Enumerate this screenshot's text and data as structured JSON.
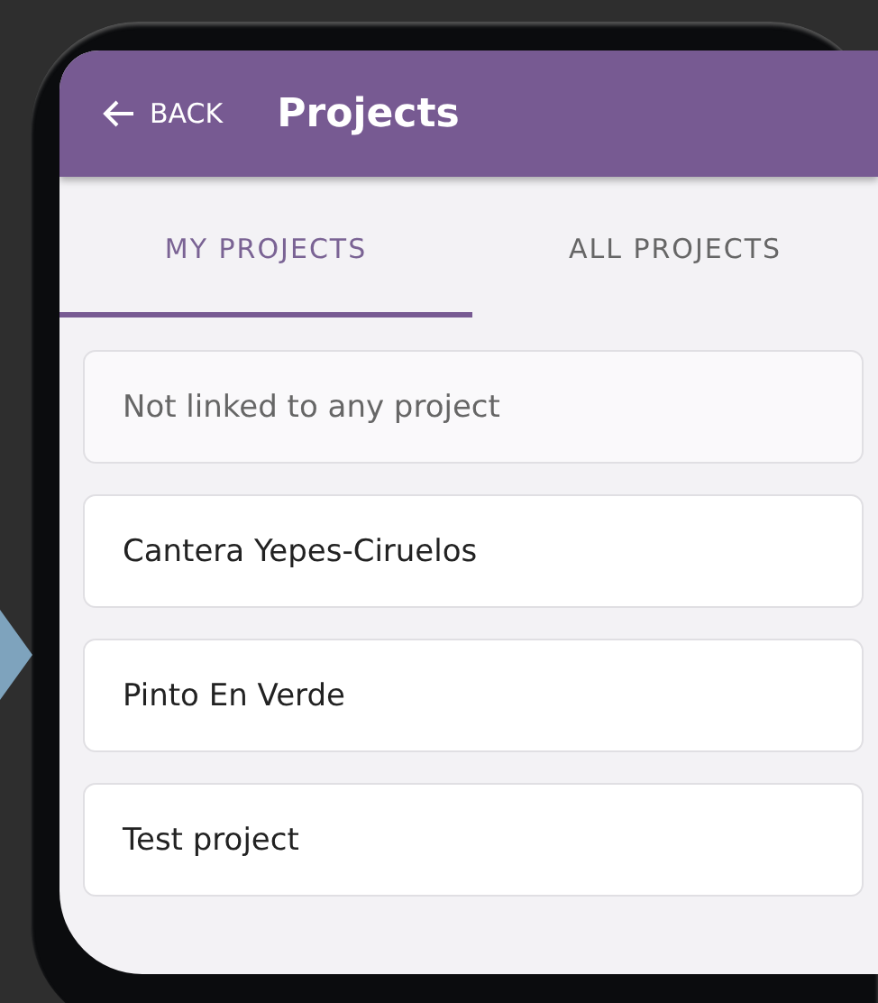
{
  "header": {
    "back_label": "BACK",
    "title": "Projects"
  },
  "tabs": [
    {
      "label": "MY PROJECTS",
      "selected": true
    },
    {
      "label": "ALL PROJECTS",
      "selected": false
    }
  ],
  "projects": [
    {
      "name": "Not linked to any project",
      "kind": "unlinked"
    },
    {
      "name": "Cantera Yepes-Ciruelos",
      "kind": "project"
    },
    {
      "name": "Pinto En Verde",
      "kind": "project"
    },
    {
      "name": "Test project",
      "kind": "project"
    }
  ]
}
